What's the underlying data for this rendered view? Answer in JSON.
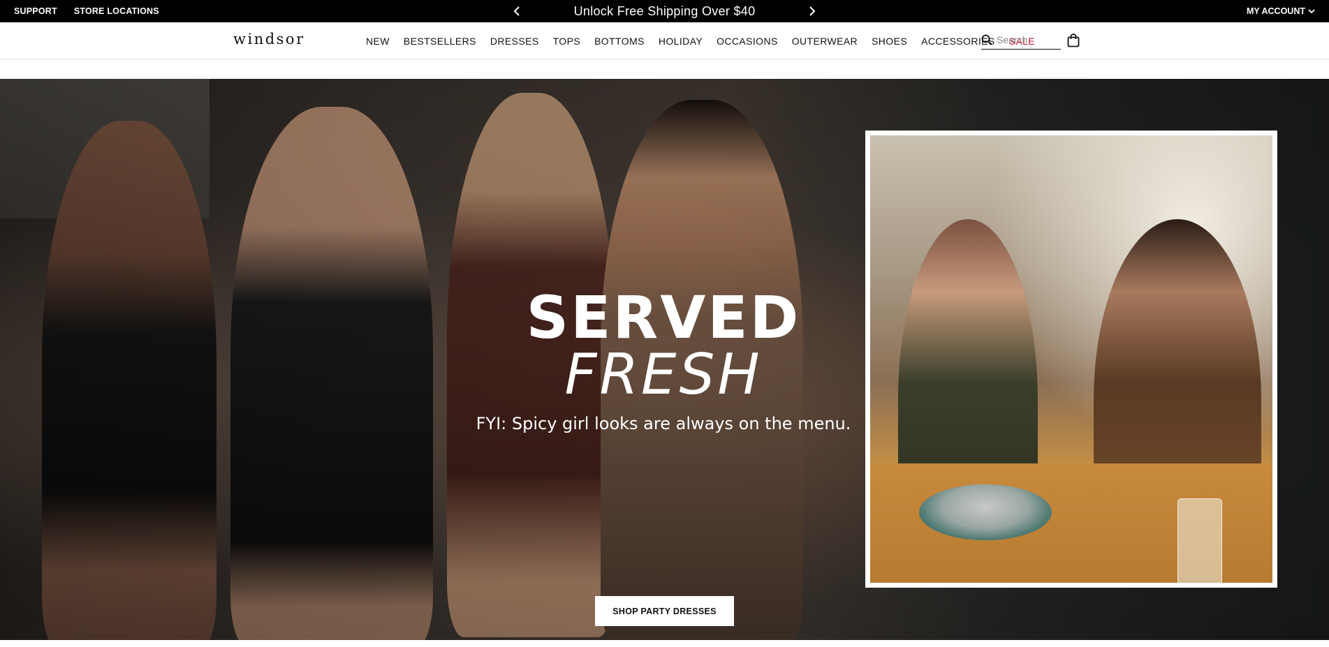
{
  "topbar": {
    "support": "SUPPORT",
    "store_locations": "STORE LOCATIONS",
    "promo_text": "Unlock Free Shipping Over $40",
    "my_account": "MY ACCOUNT"
  },
  "nav": {
    "logo": "windsor",
    "items": [
      "NEW",
      "BESTSELLERS",
      "DRESSES",
      "TOPS",
      "BOTTOMS",
      "HOLIDAY",
      "OCCASIONS",
      "OUTERWEAR",
      "SHOES",
      "ACCESSORIES",
      "SALE"
    ],
    "search_placeholder": "Search"
  },
  "hero": {
    "headline_line1": "SERVED",
    "headline_line2": "FRESH",
    "subline": "FYI: Spicy girl looks are always on the menu.",
    "cta": "SHOP PARTY DRESSES"
  },
  "colors": {
    "topbar_bg": "#000000",
    "sale": "#c8102e",
    "text": "#111111"
  },
  "icons": [
    "chevron-left-icon",
    "chevron-right-icon",
    "chevron-down-icon",
    "search-icon",
    "shopping-bag-icon"
  ]
}
